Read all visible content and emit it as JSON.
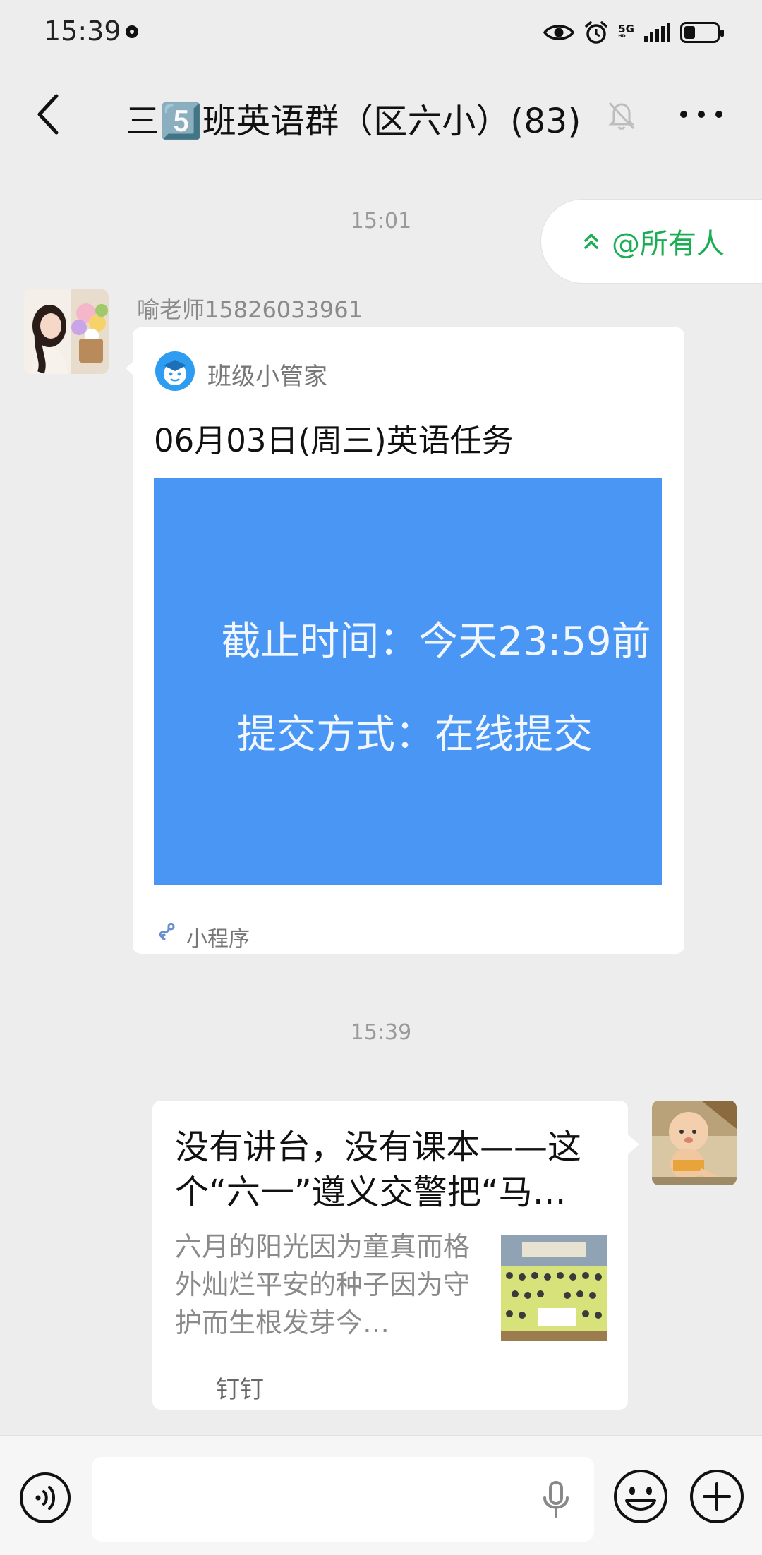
{
  "status_bar": {
    "time": "15:39",
    "network": "5G",
    "icons": [
      "eye-icon",
      "alarm-icon",
      "signal-icon",
      "battery-icon"
    ],
    "battery_level": 0.35
  },
  "header": {
    "title": "三5️⃣班英语群（区六小）(83)",
    "icons": [
      "back-arrow-icon",
      "bell-muted-icon",
      "more-dots-icon"
    ]
  },
  "mention": {
    "label": "@所有人",
    "icon": "double-chevron-up-icon"
  },
  "messages": [
    {
      "timestamp": "15:01",
      "sender": "喻老师15826033961",
      "type": "mini-program",
      "app_name": "班级小管家",
      "title": "06月03日(周三)英语任务",
      "image_lines": [
        "截止时间：今天23:59前",
        "提交方式：在线提交"
      ],
      "footer_label": "小程序",
      "footer_icon": "link-chain-icon"
    },
    {
      "timestamp": "15:39",
      "type": "link",
      "title": "没有讲台，没有课本——这个“六一”遵义交警把“马…",
      "description": "六月的阳光因为童真而格外灿烂平安的种子因为守护而生根发芽今…",
      "source": "钉钉"
    }
  ],
  "input_bar": {
    "placeholder": "",
    "icons": [
      "voice-icon",
      "microphone-icon",
      "emoji-icon",
      "plus-icon"
    ]
  },
  "colors": {
    "background": "#ededed",
    "accent_green": "#1aad53",
    "mini_program_image": "#4996f5",
    "card": "#ffffff"
  }
}
